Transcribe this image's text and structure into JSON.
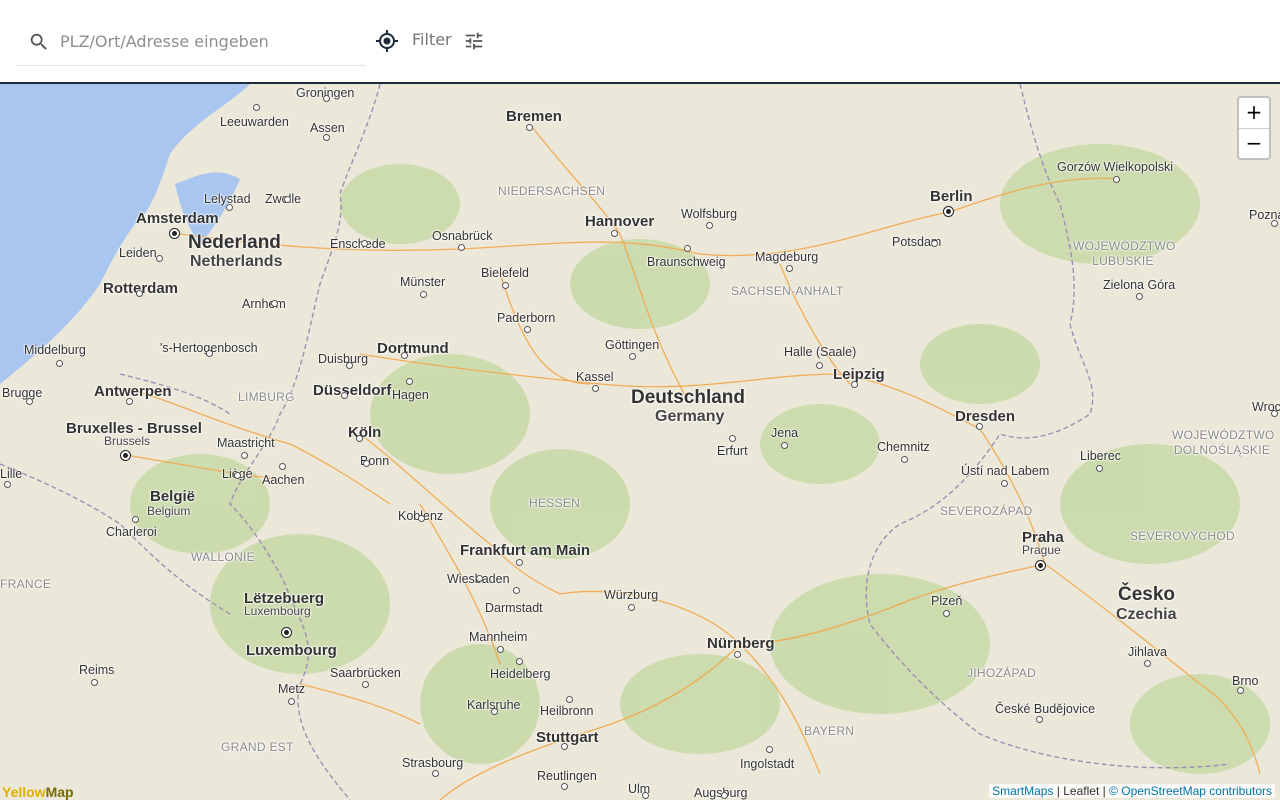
{
  "search": {
    "placeholder": "PLZ/Ort/Adresse eingeben"
  },
  "filter": {
    "label": "Filter"
  },
  "icons": {
    "search": "search-icon",
    "locate": "my-location-icon",
    "filter": "tune-icon"
  },
  "zoom": {
    "in": "+",
    "out": "−"
  },
  "attribution": {
    "smartmaps": "SmartMaps",
    "sep1": " | Leaflet | ",
    "osm": "© OpenStreetMap contributors"
  },
  "logo": {
    "part1": "Yellow",
    "part2": "Map"
  },
  "countries": [
    {
      "name": "Nederland",
      "sub": "Netherlands"
    },
    {
      "name": "Deutschland",
      "sub": "Germany"
    },
    {
      "name": "België",
      "sub": "Belgium"
    },
    {
      "name": "Lëtzebuerg",
      "sub": "Luxembourg"
    },
    {
      "name": "Česko",
      "sub": "Czechia"
    }
  ],
  "regions": [
    "NIEDERSACHSEN",
    "SACHSEN-ANHALT",
    "HESSEN",
    "LIMBURG",
    "WALLONIE",
    "FRANCE",
    "GRAND EST",
    "BAYERN",
    "SEVEROZÁPAD",
    "SEVEROVÝCHOD",
    "JIHOZÁPAD",
    "WOJEWÓDZTWO LUBUSKIE",
    "WOJEWÓDZTWO DOLNOŚLĄSKIE"
  ],
  "cities": [
    "Groningen",
    "Leeuwarden",
    "Assen",
    "Bremen",
    "Lelystad",
    "Zwolle",
    "Amsterdam",
    "Hannover",
    "Wolfsburg",
    "Berlin",
    "Gorzów Wielkopolski",
    "Leiden",
    "Enschede",
    "Osnabrück",
    "Braunschweig",
    "Magdeburg",
    "Potsdam",
    "Rotterdam",
    "Arnhem",
    "Bielefeld",
    "Münster",
    "Zielona Góra",
    "Paderborn",
    "Middelburg",
    "'s-Hertogenbosch",
    "Dortmund",
    "Göttingen",
    "Halle (Saale)",
    "Duisburg",
    "Brugge",
    "Antwerpen",
    "Düsseldorf",
    "Hagen",
    "Kassel",
    "Leipzig",
    "Dresden",
    "Bruxelles - Brussel",
    "Brussels",
    "Maastricht",
    "Köln",
    "Jena",
    "Erfurt",
    "Chemnitz",
    "Liberec",
    "Bonn",
    "Liège",
    "Aachen",
    "Ústí nad Labem",
    "Koblenz",
    "Charleroi",
    "Frankfurt am Main",
    "Praha",
    "Prague",
    "Wiesbaden",
    "Darmstadt",
    "Würzburg",
    "Plzeň",
    "Mannheim",
    "Nürnberg",
    "Reims",
    "Metz",
    "Heidelberg",
    "Saarbrücken",
    "Jihlava",
    "Karlsruhe",
    "Heilbronn",
    "Brno",
    "Stuttgart",
    "České Budějovice",
    "Ingolstadt",
    "Strasbourg",
    "Reutlingen",
    "Ulm",
    "Augsburg",
    "Luxembourg",
    "Poznań",
    "Wrocław",
    "Lille"
  ]
}
